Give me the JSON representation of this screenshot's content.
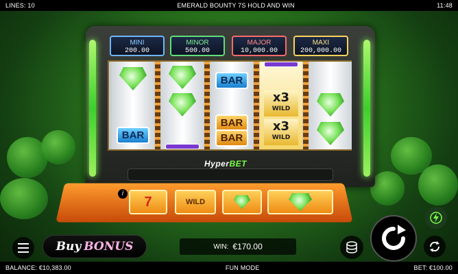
{
  "topbar": {
    "lines": "LINES: 10",
    "title": "EMERALD BOUNTY 7S HOLD AND WIN",
    "time": "11:48"
  },
  "jackpots": [
    {
      "name": "MINI",
      "value": "200.00",
      "color": "#6fb6ff"
    },
    {
      "name": "MINOR",
      "value": "500.00",
      "color": "#5fe07a"
    },
    {
      "name": "MAJOR",
      "value": "10,000.00",
      "color": "#ff6b6b"
    },
    {
      "name": "MAXI",
      "value": "200,000.00",
      "color": "#ffd45a"
    }
  ],
  "reels": [
    [
      "emerald",
      "empty",
      "bar-blue"
    ],
    [
      "emerald",
      "emerald",
      "bar-purple"
    ],
    [
      "bar-blue",
      "bar-gold",
      "bar-gold"
    ],
    [
      "wild-x3",
      "wild-x3",
      "wild"
    ],
    [
      "empty",
      "emerald",
      "emerald"
    ]
  ],
  "wild_symbol": {
    "multiplier": "x3",
    "text": "WILD"
  },
  "bar_symbol": "BAR",
  "logo": {
    "left": "Hyper",
    "right": "BET"
  },
  "feature_tiles": [
    "7",
    "WILD",
    "gem",
    "gems"
  ],
  "info_icon": "i",
  "buy_bonus": {
    "buy": "Buy",
    "bonus": "BONUS"
  },
  "win": {
    "label": "WIN:",
    "value": "€170.00"
  },
  "bottombar": {
    "balance": "BALANCE: €10,383.00",
    "mode": "FUN MODE",
    "bet": "BET: €100.00"
  },
  "colors": {
    "accent_green": "#7dff4a",
    "tray_orange": "#ff9d2e"
  }
}
